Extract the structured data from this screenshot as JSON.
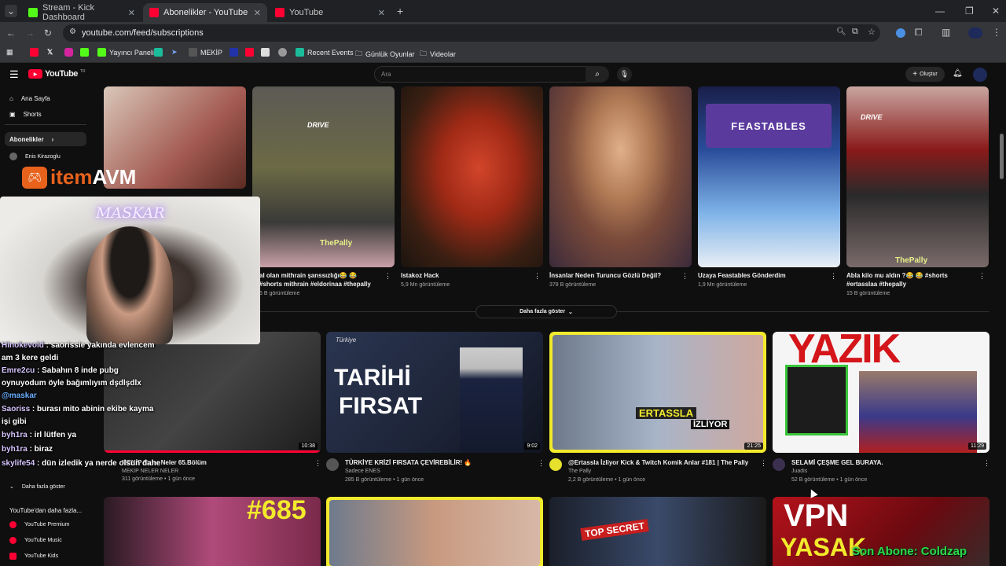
{
  "browser": {
    "tabs": [
      {
        "label": "Stream - Kick Dashboard",
        "color": "#53fc18"
      },
      {
        "label": "Abonelikler - YouTube",
        "color": "#ff0033"
      },
      {
        "label": "YouTube",
        "color": "#ff0033"
      }
    ],
    "url": "youtube.com/feed/subscriptions",
    "bookmarks": [
      "Yayıncı Paneli",
      "MEKİP",
      "Recent Events",
      "Günlük Oyunlar",
      "Videolar"
    ]
  },
  "youtube": {
    "logo": "YouTube",
    "logo_sup": "TR",
    "search_placeholder": "Ara",
    "create_label": "Oluştur",
    "sidebar": {
      "home": "Ana Sayfa",
      "shorts": "Shorts",
      "subscriptions": "Abonelikler",
      "channels": [
        "Enis Kirazoglu"
      ],
      "show_more": "Daha fazla göster",
      "more_from": "YouTube'dan daha fazla...",
      "products": [
        "YouTube Premium",
        "YouTube Music",
        "YouTube Kids"
      ]
    },
    "shorts": [
      {
        "title": "al olan mithrain şanssızlığı😂 😂 #shorts mithrain #eldorinaa #thepally",
        "views": "5 B görüntüleme"
      },
      {
        "title": "Istakoz Hack",
        "views": "5,9 Mn görüntüleme"
      },
      {
        "title": "İnsanlar Neden Turuncu Gözlü Değil?",
        "views": "378 B görüntüleme"
      },
      {
        "title": "Uzaya Feastables Gönderdim",
        "views": "1,9 Mn görüntüleme"
      },
      {
        "title": "Abla kilo mu aldın ?😂 😂 #shorts #ertasslaa #thepally",
        "views": "15 B görüntüleme"
      }
    ],
    "show_more_button": "Daha fazla göster",
    "videos": [
      {
        "title": "MEKİP Neler Neler 65.Bölüm",
        "channel": "MEKİP NELER NELER",
        "meta": "311 görüntüleme • 1 gün önce",
        "duration": "10:38"
      },
      {
        "title": "TÜRKİYE KRİZİ FIRSATA ÇEVİREBİLİR! 🔥",
        "channel": "Sadece ENES",
        "meta": "285 B görüntüleme • 1 gün önce",
        "duration": "9:02"
      },
      {
        "title": "@Ertassla İzliyor Kick & Twitch Komik Anlar #181 | The Pally",
        "channel": "The Pally",
        "meta": "2,2 B görüntüleme • 1 gün önce",
        "duration": "21:25"
      },
      {
        "title": "SELAMİ ÇEŞME GEL BURAYA.",
        "channel": "Juadis",
        "meta": "52 B görüntüleme • 1 gün önce",
        "duration": "11:29"
      }
    ],
    "thumb_texts": {
      "drive": "DRIVE",
      "thepally": "ThePally",
      "feastables": "FEASTABLES",
      "turkiye": "Türkiye",
      "tarihi": "TARİHİ",
      "firsat": "FIRSAT",
      "ertassla": "ERTASSLA",
      "izliyor": "İZLİYOR",
      "yazik": "YAZIK",
      "n685": "#685",
      "topsecret": "TOP SECRET",
      "vpn": "VPN",
      "yasak": "YASAK"
    }
  },
  "stream_overlay": {
    "sponsor_prefix": "item",
    "sponsor_suffix": "AVM",
    "cam_label": "MASKAR",
    "chat": [
      {
        "user": "Hinokevoid",
        "text": " : saorissie yakında evlencem"
      },
      {
        "user": "",
        "text": "am 3 kere geldi"
      },
      {
        "user": "Emre2cu",
        "text": " : Sabahın 8 inde pubg"
      },
      {
        "user": "",
        "text": "oynuyodum öyle bağımlıyım dşdlşdlx"
      },
      {
        "user": "@maskar",
        "text": ""
      },
      {
        "user": "Saoriss",
        "text": " : burası mito abinin ekibe kayma"
      },
      {
        "user": "",
        "text": "işi gibi"
      },
      {
        "user": "byh1ra",
        "text": " : irl lütfen ya"
      },
      {
        "user": "byh1ra",
        "text": " : biraz"
      },
      {
        "user": "skylife54",
        "text": " : dün izledik ya nerde olsun dahe"
      }
    ],
    "ticker": "Son Abone: Coldzap"
  },
  "colors": {
    "yt_red": "#ff0033",
    "kick_green": "#53fc18"
  }
}
